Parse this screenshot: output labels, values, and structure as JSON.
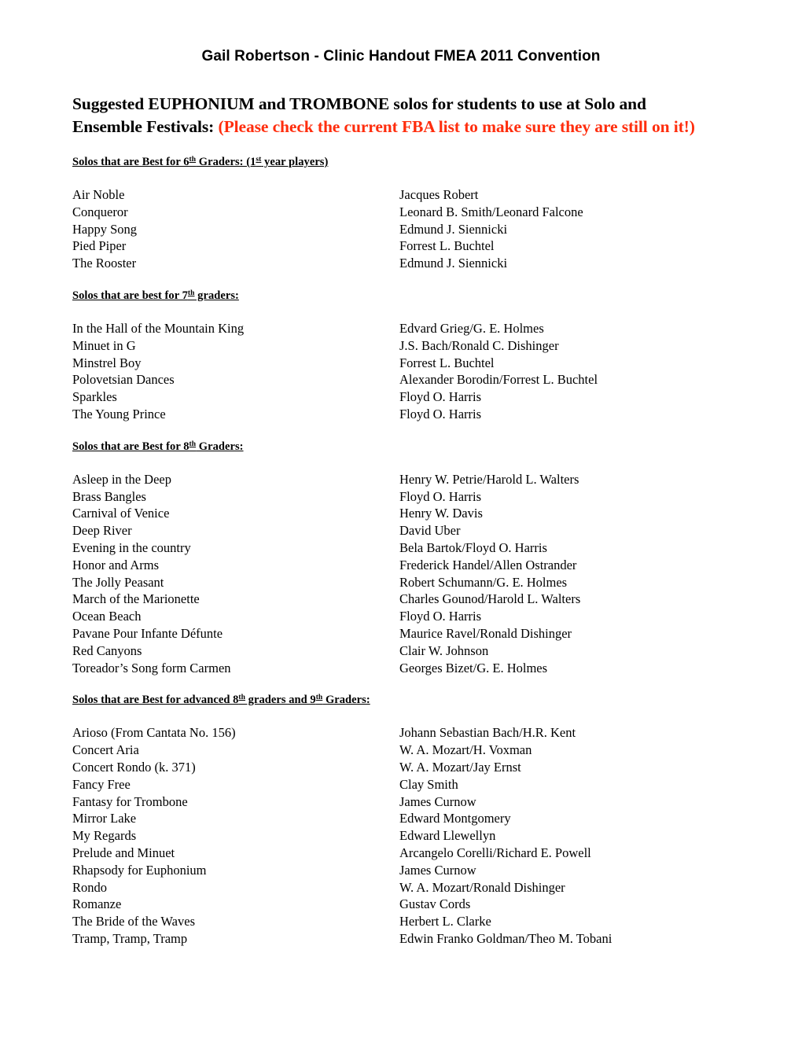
{
  "document": {
    "title": "Gail Robertson - Clinic Handout FMEA 2011 Convention",
    "subtitle_line1": "Suggested EUPHONIUM and TROMBONE solos for students to use at Solo and",
    "subtitle_line2_black": "Ensemble Festivals: ",
    "subtitle_line2_red": "(Please check the current FBA list to make sure they are still on it!)",
    "accent_color": "#ff2d0d",
    "text_color": "#000000",
    "background_color": "#ffffff"
  },
  "sections": [
    {
      "heading_parts": {
        "pre": "Solos that are Best for 6",
        "sup1": "th",
        "mid": " Graders: (1",
        "sup2": "st",
        "post": " year players)"
      },
      "heading_text": "Solos that are Best for 6th Graders: (1st year players)",
      "entries": [
        {
          "title": "Air Noble",
          "composer": "Jacques Robert"
        },
        {
          "title": "Conqueror",
          "composer": "Leonard B. Smith/Leonard Falcone"
        },
        {
          "title": "Happy Song",
          "composer": "Edmund J. Siennicki"
        },
        {
          "title": "Pied Piper",
          "composer": "Forrest L. Buchtel"
        },
        {
          "title": "The Rooster",
          "composer": "Edmund J. Siennicki"
        }
      ]
    },
    {
      "heading_parts": {
        "pre": "Solos that are best for 7",
        "sup1": "th",
        "mid": " graders:",
        "sup2": "",
        "post": ""
      },
      "heading_text": "Solos that are best for 7th graders:",
      "entries": [
        {
          "title": "In the Hall of the Mountain King",
          "composer": "Edvard Grieg/G. E. Holmes"
        },
        {
          "title": "Minuet in G",
          "composer": "J.S. Bach/Ronald C. Dishinger"
        },
        {
          "title": "Minstrel Boy",
          "composer": "Forrest L. Buchtel"
        },
        {
          "title": "Polovetsian Dances",
          "composer": "Alexander Borodin/Forrest L. Buchtel"
        },
        {
          "title": "Sparkles",
          "composer": "Floyd O. Harris"
        },
        {
          "title": "The Young Prince",
          "composer": "Floyd O. Harris"
        }
      ]
    },
    {
      "heading_parts": {
        "pre": "Solos that are Best for 8",
        "sup1": "th",
        "mid": " Graders:",
        "sup2": "",
        "post": ""
      },
      "heading_text": "Solos that are Best for 8th Graders:",
      "entries": [
        {
          "title": "Asleep in the Deep",
          "composer": "Henry W. Petrie/Harold L. Walters"
        },
        {
          "title": "Brass Bangles",
          "composer": "Floyd O. Harris"
        },
        {
          "title": "Carnival of Venice",
          "composer": "Henry W. Davis"
        },
        {
          "title": "Deep River",
          "composer": "David Uber"
        },
        {
          "title": "Evening in the country",
          "composer": "Bela Bartok/Floyd O. Harris"
        },
        {
          "title": "Honor and Arms",
          "composer": "Frederick Handel/Allen Ostrander"
        },
        {
          "title": "The Jolly Peasant",
          "composer": "Robert Schumann/G. E. Holmes"
        },
        {
          "title": "March of the Marionette",
          "composer": "Charles Gounod/Harold L. Walters"
        },
        {
          "title": "Ocean Beach",
          "composer": "Floyd O. Harris"
        },
        {
          "title": "Pavane Pour Infante Défunte",
          "composer": "Maurice Ravel/Ronald Dishinger"
        },
        {
          "title": "Red Canyons",
          "composer": "Clair W. Johnson"
        },
        {
          "title": "Toreador’s Song form Carmen",
          "composer": "Georges Bizet/G. E. Holmes"
        }
      ]
    },
    {
      "heading_parts": {
        "pre": "Solos that are Best for advanced 8",
        "sup1": "th",
        "mid": " graders and 9",
        "sup2": "th",
        "post": " Graders:"
      },
      "heading_text": "Solos that are Best for advanced 8th graders and 9th Graders:",
      "entries": [
        {
          "title": "Arioso (From Cantata No. 156)",
          "composer": "Johann Sebastian Bach/H.R. Kent"
        },
        {
          "title": "Concert Aria",
          "composer": "W. A. Mozart/H. Voxman"
        },
        {
          "title": "Concert Rondo (k. 371)",
          "composer": "W. A. Mozart/Jay Ernst"
        },
        {
          "title": "Fancy Free",
          "composer": "Clay Smith"
        },
        {
          "title": "Fantasy for Trombone",
          "composer": "James Curnow"
        },
        {
          "title": "Mirror Lake",
          "composer": "Edward Montgomery"
        },
        {
          "title": "My Regards",
          "composer": "Edward Llewellyn"
        },
        {
          "title": "Prelude and Minuet",
          "composer": "Arcangelo Corelli/Richard E. Powell"
        },
        {
          "title": "Rhapsody for Euphonium",
          "composer": "James Curnow"
        },
        {
          "title": "Rondo",
          "composer": "W. A. Mozart/Ronald Dishinger"
        },
        {
          "title": "Romanze",
          "composer": "Gustav Cords"
        },
        {
          "title": "The Bride of the Waves",
          "composer": "Herbert L. Clarke"
        },
        {
          "title": "Tramp, Tramp, Tramp",
          "composer": "Edwin Franko Goldman/Theo M. Tobani"
        }
      ]
    }
  ]
}
